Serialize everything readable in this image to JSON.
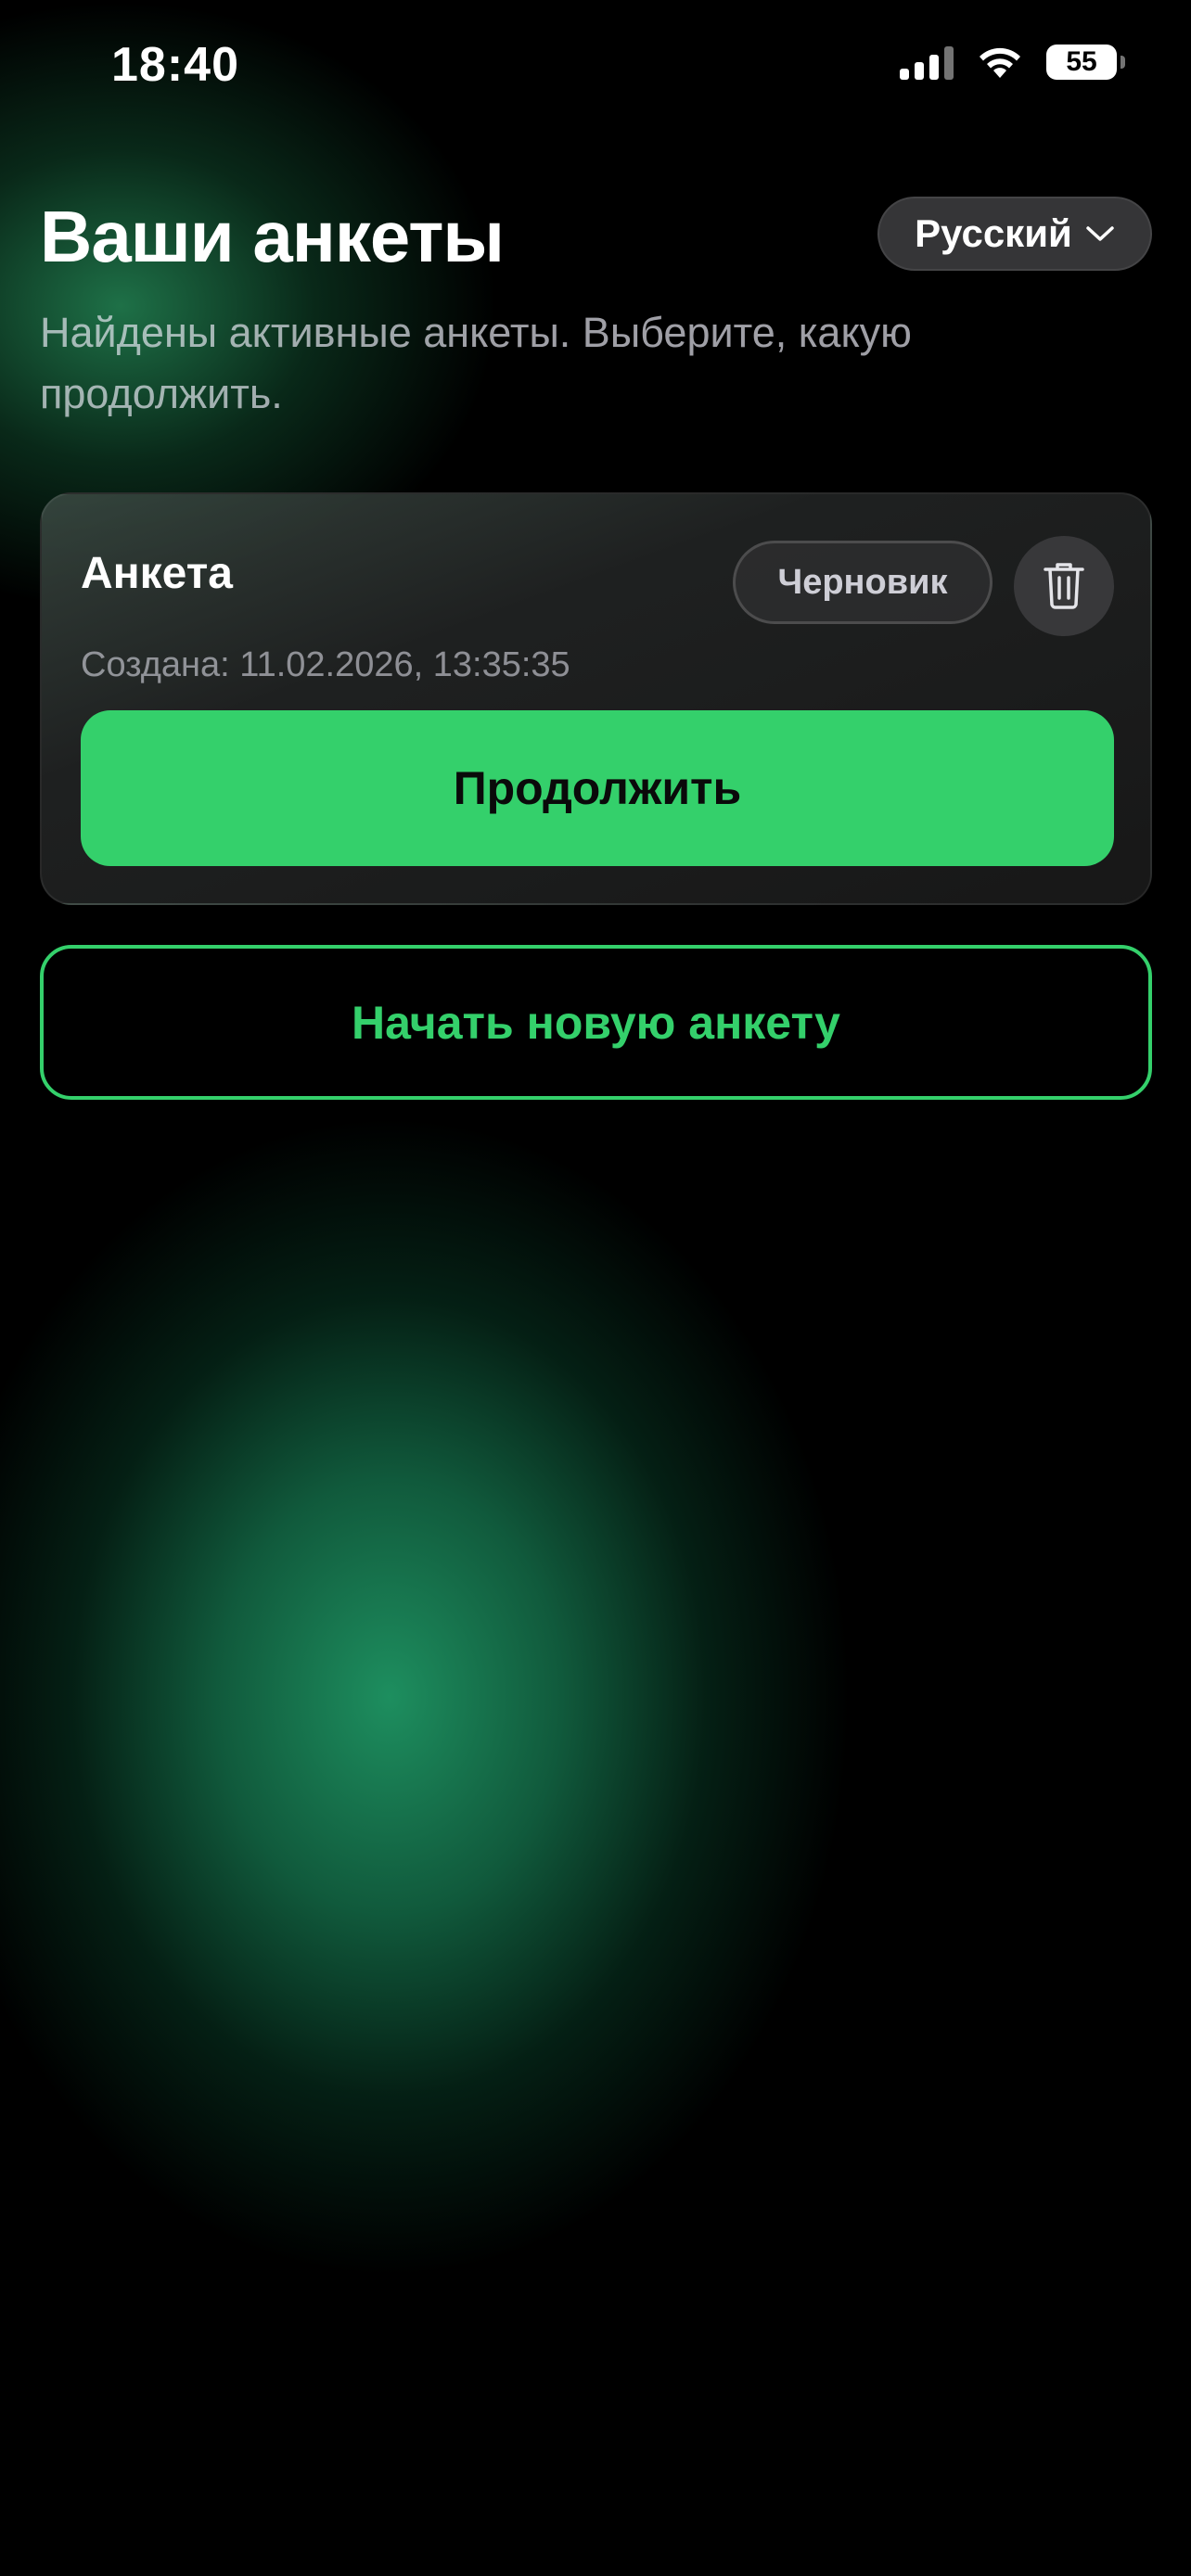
{
  "status_bar": {
    "time": "18:40",
    "battery_level": "55",
    "icons": [
      "signal-icon",
      "wifi-icon",
      "battery-icon"
    ]
  },
  "header": {
    "title": "Ваши анкеты",
    "language": "Русский",
    "subtitle": "Найдены активные анкеты. Выберите, какую продолжить."
  },
  "forms": [
    {
      "title": "Анкета",
      "status": "Черновик",
      "created": "Создана: 11.02.2026, 13:35:35",
      "continue_label": "Продолжить",
      "delete_icon": "trash-icon"
    }
  ],
  "actions": {
    "new_form_label": "Начать новую анкету"
  },
  "colors": {
    "accent": "#34d06b",
    "background": "#000000",
    "card": "#1c1c1e"
  }
}
